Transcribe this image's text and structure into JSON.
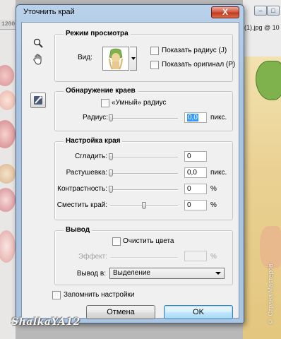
{
  "background": {
    "ruler_number": "1200",
    "document_tab": "(1).jpg @ 10",
    "window_buttons": [
      "–",
      "□"
    ],
    "watermark_left": "ShalkaYA12",
    "watermark_right": "© Страна Мастеров"
  },
  "dialog": {
    "title": "Уточнить край",
    "close_symbol": "X",
    "tools": {
      "zoom_icon": "magnifier-icon",
      "hand_icon": "hand-icon",
      "refine_brush_icon": "refine-radius-brush-icon"
    },
    "view_mode": {
      "legend": "Режим просмотра",
      "view_label": "Вид:",
      "show_radius": "Показать радиус (J)",
      "show_original": "Показать оригинал (P)"
    },
    "edge_detection": {
      "legend": "Обнаружение краев",
      "smart_radius": "«Умный» радиус",
      "radius_label": "Радиус:",
      "radius_value": "0,0",
      "radius_unit": "пикс."
    },
    "adjust_edge": {
      "legend": "Настройка края",
      "smooth_label": "Сгладить:",
      "smooth_value": "0",
      "feather_label": "Растушевка:",
      "feather_value": "0,0",
      "feather_unit": "пикс.",
      "contrast_label": "Контрастность:",
      "contrast_value": "0",
      "contrast_unit": "%",
      "shift_label": "Сместить край:",
      "shift_value": "0",
      "shift_unit": "%",
      "shift_slider_level": 0.5
    },
    "output": {
      "legend": "Вывод",
      "decontaminate": "Очистить цвета",
      "amount_label": "Эффект:",
      "amount_unit": "%",
      "output_to_label": "Вывод в:",
      "output_to_value": "Выделение"
    },
    "remember": "Запомнить настройки",
    "cancel": "Отмена",
    "ok": "OK"
  }
}
